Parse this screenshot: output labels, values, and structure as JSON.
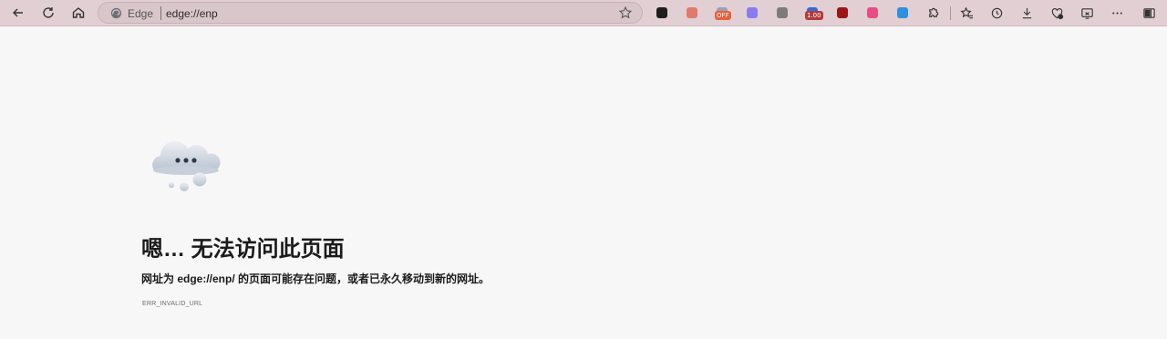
{
  "toolbar": {
    "site_label": "Edge",
    "url": "edge://enp",
    "extensions": [
      {
        "name": "ext-1",
        "color": "#1e1e1e"
      },
      {
        "name": "ext-2",
        "color": "#e07a6a"
      },
      {
        "name": "ext-3",
        "color": "#9aa0b8",
        "badge": "OFF",
        "badge_color": "#e8603a"
      },
      {
        "name": "ext-4",
        "color": "#8a7cf0"
      },
      {
        "name": "ext-5",
        "color": "#7c7c7c"
      },
      {
        "name": "ext-6",
        "color": "#2d6fd6",
        "badge": "1.00",
        "badge_color": "#b23a3a"
      },
      {
        "name": "ext-7",
        "color": "#9c1616"
      },
      {
        "name": "ext-8",
        "color": "#e64f86"
      },
      {
        "name": "ext-9",
        "color": "#2f8fe0"
      }
    ],
    "icons": [
      "extensions-icon",
      "favorites-icon",
      "history-icon",
      "downloads-icon",
      "performance-icon",
      "screenshot-icon",
      "more-icon",
      "sidebar-icon"
    ]
  },
  "page": {
    "title": "嗯… 无法访问此页面",
    "description": "网址为 edge://enp/ 的页面可能存在问题，或者已永久移动到新的网址。",
    "error_code": "ERR_INVALID_URL"
  },
  "colors": {
    "toolbar_bg": "#e2cfd4",
    "address_bg": "#d9c6cb",
    "page_bg": "#f7f7f7"
  }
}
